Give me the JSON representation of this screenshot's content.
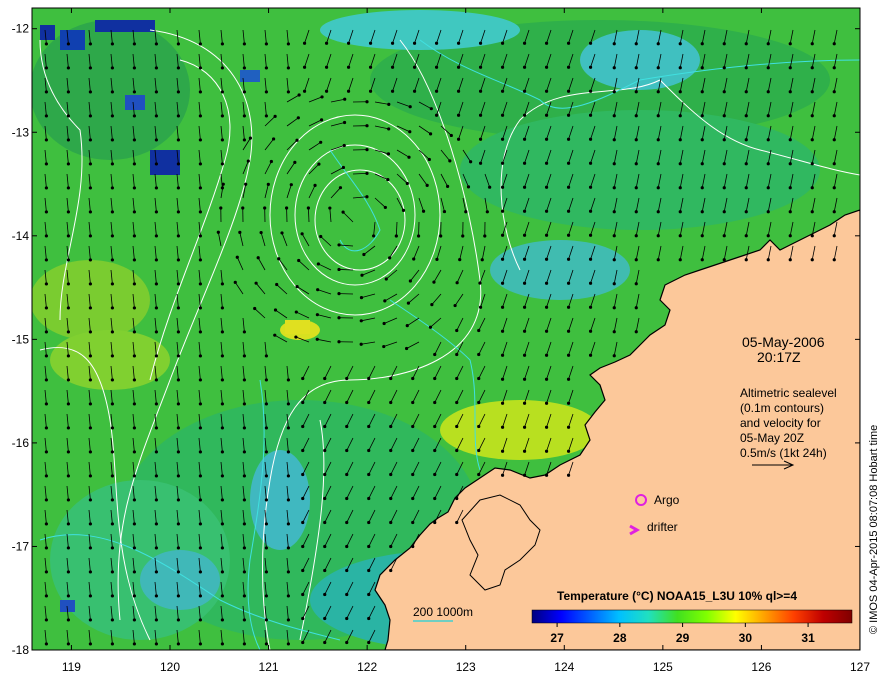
{
  "map": {
    "lon_range": [
      118.6,
      127.0
    ],
    "lat_range": [
      -18.0,
      -11.8
    ],
    "x_ticks": [
      "119",
      "120",
      "121",
      "122",
      "123",
      "124",
      "125",
      "126",
      "127"
    ],
    "y_ticks": [
      "-12",
      "-13",
      "-14",
      "-15",
      "-16",
      "-17",
      "-18"
    ]
  },
  "datetime": {
    "date": "05-May-2006",
    "time": "20:17Z"
  },
  "altimetry_note": {
    "lines": [
      "Altimetric sealevel",
      "(0.1m contours)",
      "and velocity for",
      "05-May 20Z",
      "0.5m/s (1kt 24h)"
    ]
  },
  "markers": {
    "argo_label": "Argo",
    "drifter_label": "drifter",
    "argo_color": "#e020e0",
    "drifter_color": "#e020e0"
  },
  "bathymetry_legend": {
    "label": "200  1000m",
    "color": "#40d0d0"
  },
  "colorbar": {
    "title": "Temperature (°C) NOAA15_L3U 10% ql>=4",
    "ticks": [
      "27",
      "28",
      "29",
      "30",
      "31"
    ],
    "colors": [
      "#00007f",
      "#0000ff",
      "#0060ff",
      "#00c0ff",
      "#20e0c0",
      "#40e020",
      "#80ff00",
      "#ffff00",
      "#ffa000",
      "#ff4000",
      "#c00000",
      "#7f0000"
    ]
  },
  "credit": "© IMOS 04-Apr-2015 08:07:08 Hobart time",
  "colors": {
    "land": "#fcc89a",
    "sea_base": "#40c040",
    "contour_white": "#ffffff",
    "contour_cyan": "#40e0e0"
  }
}
